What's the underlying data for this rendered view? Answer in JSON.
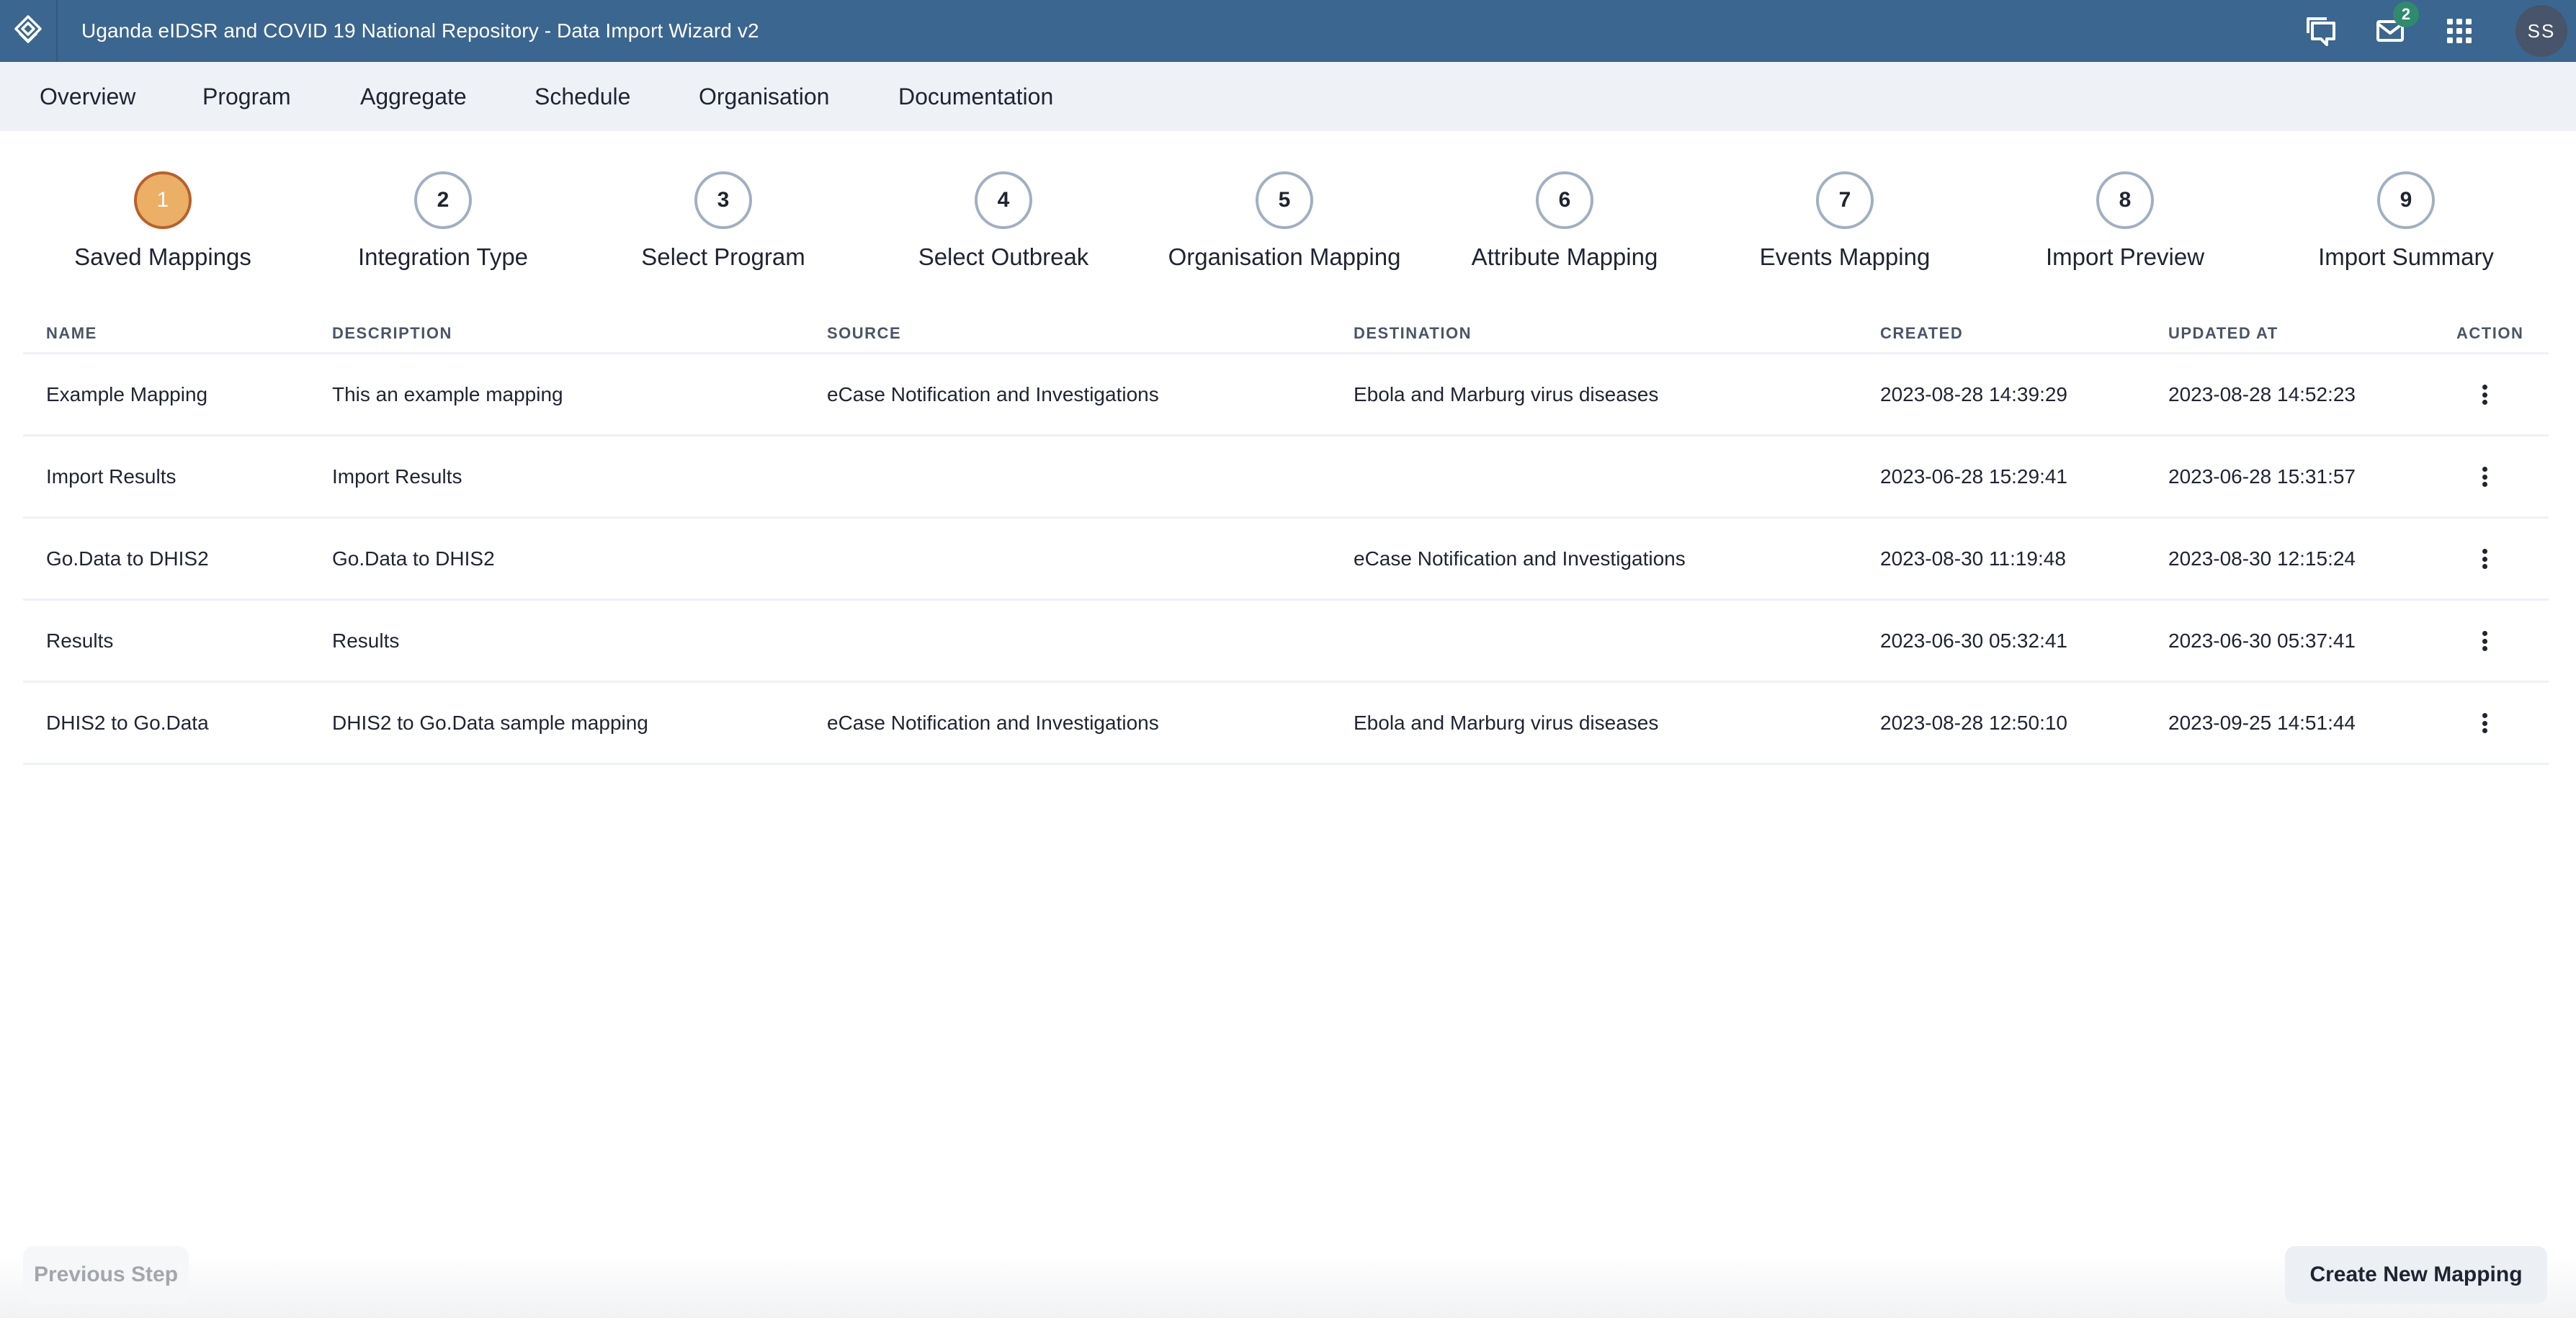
{
  "header": {
    "title": "Uganda eIDSR and COVID 19 National Repository - Data Import Wizard v2",
    "messages_badge": "2",
    "user_initials": "SS",
    "icons": [
      "logo-icon",
      "interpretations-icon",
      "messages-icon",
      "apps-icon",
      "profile-avatar"
    ]
  },
  "nav": {
    "items": [
      {
        "label": "Overview"
      },
      {
        "label": "Program"
      },
      {
        "label": "Aggregate"
      },
      {
        "label": "Schedule"
      },
      {
        "label": "Organisation"
      },
      {
        "label": "Documentation"
      }
    ]
  },
  "stepper": {
    "active_step": 1,
    "steps": [
      {
        "number": "1",
        "label": "Saved Mappings"
      },
      {
        "number": "2",
        "label": "Integration Type"
      },
      {
        "number": "3",
        "label": "Select Program"
      },
      {
        "number": "4",
        "label": "Select Outbreak"
      },
      {
        "number": "5",
        "label": "Organisation Mapping"
      },
      {
        "number": "6",
        "label": "Attribute Mapping"
      },
      {
        "number": "7",
        "label": "Events Mapping"
      },
      {
        "number": "8",
        "label": "Import Preview"
      },
      {
        "number": "9",
        "label": "Import Summary"
      }
    ]
  },
  "table": {
    "columns": [
      "NAME",
      "DESCRIPTION",
      "SOURCE",
      "DESTINATION",
      "CREATED",
      "UPDATED AT",
      "ACTION"
    ],
    "rows": [
      {
        "name": "Example Mapping",
        "description": "This an example mapping",
        "source": "eCase Notification and Investigations",
        "destination": "Ebola and Marburg virus diseases",
        "created": "2023-08-28 14:39:29",
        "updated": "2023-08-28 14:52:23"
      },
      {
        "name": "Import Results",
        "description": "Import Results",
        "source": "",
        "destination": "",
        "created": "2023-06-28 15:29:41",
        "updated": "2023-06-28 15:31:57"
      },
      {
        "name": "Go.Data to DHIS2",
        "description": "Go.Data to DHIS2",
        "source": "",
        "destination": "eCase Notification and Investigations",
        "created": "2023-08-30 11:19:48",
        "updated": "2023-08-30 12:15:24"
      },
      {
        "name": "Results",
        "description": "Results",
        "source": "",
        "destination": "",
        "created": "2023-06-30 05:32:41",
        "updated": "2023-06-30 05:37:41"
      },
      {
        "name": "DHIS2 to Go.Data",
        "description": "DHIS2 to Go.Data sample mapping",
        "source": "eCase Notification and Investigations",
        "destination": "Ebola and Marburg virus diseases",
        "created": "2023-08-28 12:50:10",
        "updated": "2023-09-25 14:51:44"
      }
    ]
  },
  "footer": {
    "previous_label": "Previous Step",
    "create_label": "Create New Mapping"
  },
  "colors": {
    "header_bg": "#3b6690",
    "nav_bg": "#eef1f6",
    "active_step_fill": "#ebaf65",
    "active_step_border": "#b8602d",
    "inactive_step_border": "#a2afc2",
    "badge": "#2f8a6e"
  }
}
